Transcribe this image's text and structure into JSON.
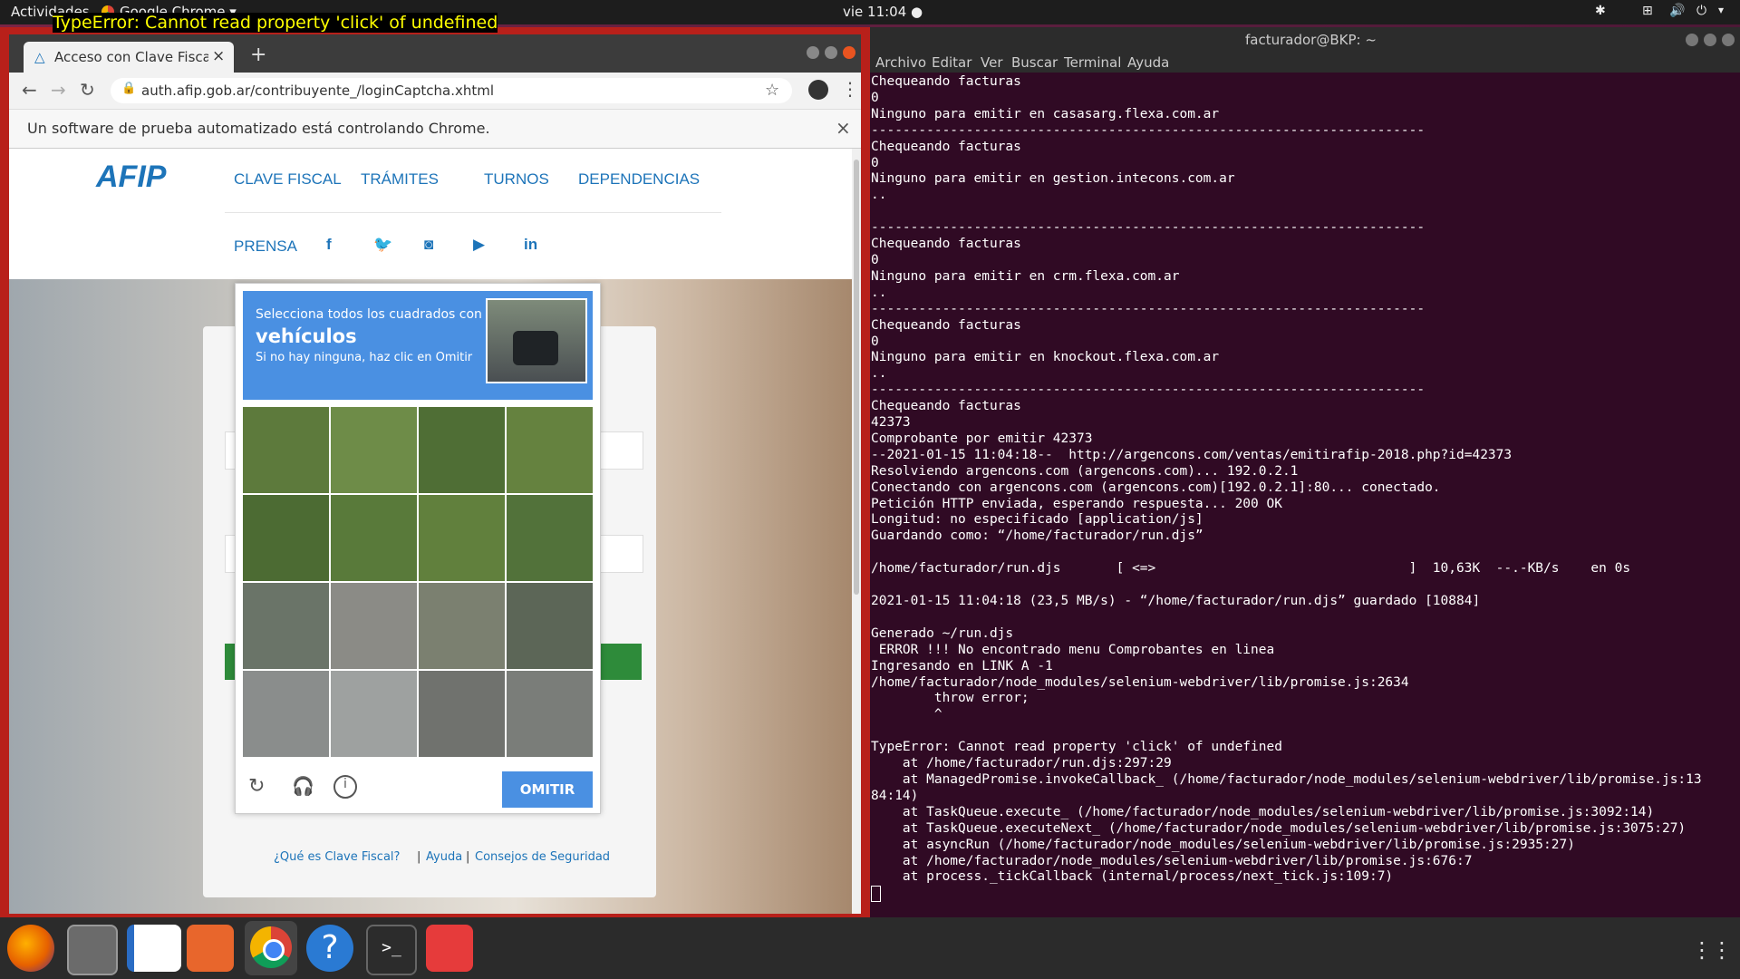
{
  "topbar": {
    "activities": "Actividades",
    "app": "Google Chrome ▾",
    "clock": "vie 11:04 ●"
  },
  "error_overlay": "TypeError: Cannot read property 'click' of undefined",
  "chrome": {
    "tab_title": "Acceso con Clave Fiscal - A",
    "url": "auth.afip.gob.ar/contribuyente_/loginCaptcha.xhtml",
    "infobar": "Un software de prueba automatizado está controlando Chrome.",
    "nav_items": [
      "CLAVE FISCAL",
      "TRÁMITES",
      "TURNOS",
      "DEPENDENCIAS",
      "PRENSA"
    ],
    "logo": "AFIP",
    "footer_links": [
      "¿Qué es Clave Fiscal?",
      "Ayuda",
      "Consejos de Seguridad"
    ]
  },
  "captcha": {
    "line1": "Selecciona todos los cuadrados con",
    "keyword": "vehículos",
    "line3": "Si no hay ninguna, haz clic en Omitir",
    "skip_button": "OMITIR"
  },
  "terminal": {
    "title": "facturador@BKP: ~",
    "menu": [
      "Archivo",
      "Editar",
      "Ver",
      "Buscar",
      "Terminal",
      "Ayuda"
    ],
    "lines": [
      "Chequeando facturas",
      "0",
      "Ninguno para emitir en casasarg.flexa.com.ar",
      "----------------------------------------------------------------------",
      "Chequeando facturas",
      "0",
      "Ninguno para emitir en gestion.intecons.com.ar",
      "..",
      "",
      "----------------------------------------------------------------------",
      "Chequeando facturas",
      "0",
      "Ninguno para emitir en crm.flexa.com.ar",
      "..",
      "----------------------------------------------------------------------",
      "Chequeando facturas",
      "0",
      "Ninguno para emitir en knockout.flexa.com.ar",
      "..",
      "----------------------------------------------------------------------",
      "Chequeando facturas",
      "42373",
      "Comprobante por emitir 42373",
      "--2021-01-15 11:04:18--  http://argencons.com/ventas/emitirafip-2018.php?id=42373",
      "Resolviendo argencons.com (argencons.com)... 192.0.2.1",
      "Conectando con argencons.com (argencons.com)[192.0.2.1]:80... conectado.",
      "Petición HTTP enviada, esperando respuesta... 200 OK",
      "Longitud: no especificado [application/js]",
      "Guardando como: “/home/facturador/run.djs”",
      "",
      "/home/facturador/run.djs       [ <=>                                ]  10,63K  --.-KB/s    en 0s",
      "",
      "2021-01-15 11:04:18 (23,5 MB/s) - “/home/facturador/run.djs” guardado [10884]",
      "",
      "Generado ~/run.djs",
      " ERROR !!! No encontrado menu Comprobantes en linea",
      "Ingresando en LINK A -1",
      "/home/facturador/node_modules/selenium-webdriver/lib/promise.js:2634",
      "        throw error;",
      "        ^",
      "",
      "TypeError: Cannot read property 'click' of undefined",
      "    at /home/facturador/run.djs:297:29",
      "    at ManagedPromise.invokeCallback_ (/home/facturador/node_modules/selenium-webdriver/lib/promise.js:13",
      "84:14)",
      "    at TaskQueue.execute_ (/home/facturador/node_modules/selenium-webdriver/lib/promise.js:3092:14)",
      "    at TaskQueue.executeNext_ (/home/facturador/node_modules/selenium-webdriver/lib/promise.js:3075:27)",
      "    at asyncRun (/home/facturador/node_modules/selenium-webdriver/lib/promise.js:2935:27)",
      "    at /home/facturador/node_modules/selenium-webdriver/lib/promise.js:676:7",
      "    at process._tickCallback (internal/process/next_tick.js:109:7)"
    ]
  },
  "dock": [
    "firefox-icon",
    "files-icon",
    "writer-icon",
    "software-center-icon",
    "chrome-icon",
    "help-icon",
    "terminal-icon",
    "anydesk-icon",
    "app-grid-icon"
  ]
}
